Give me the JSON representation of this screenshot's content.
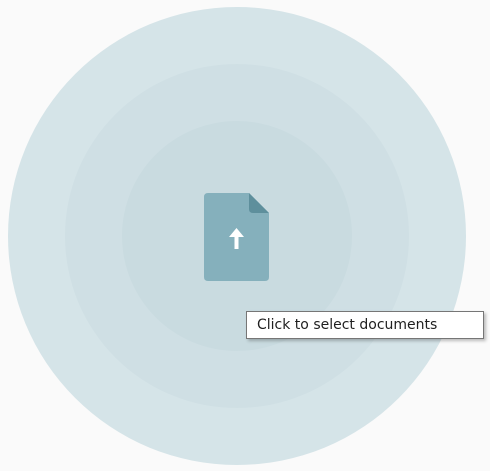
{
  "upload": {
    "icon": "file-upload-icon",
    "tooltip": "Click to select documents"
  },
  "colors": {
    "background": "#fafafa",
    "ring_outer": "#d5e4e8",
    "ring_middle": "#cfdfe4",
    "ring_inner": "#c9dbe0",
    "file_icon": "#85b0bc",
    "file_icon_fold": "#5e8f9c",
    "arrow": "#ffffff"
  }
}
